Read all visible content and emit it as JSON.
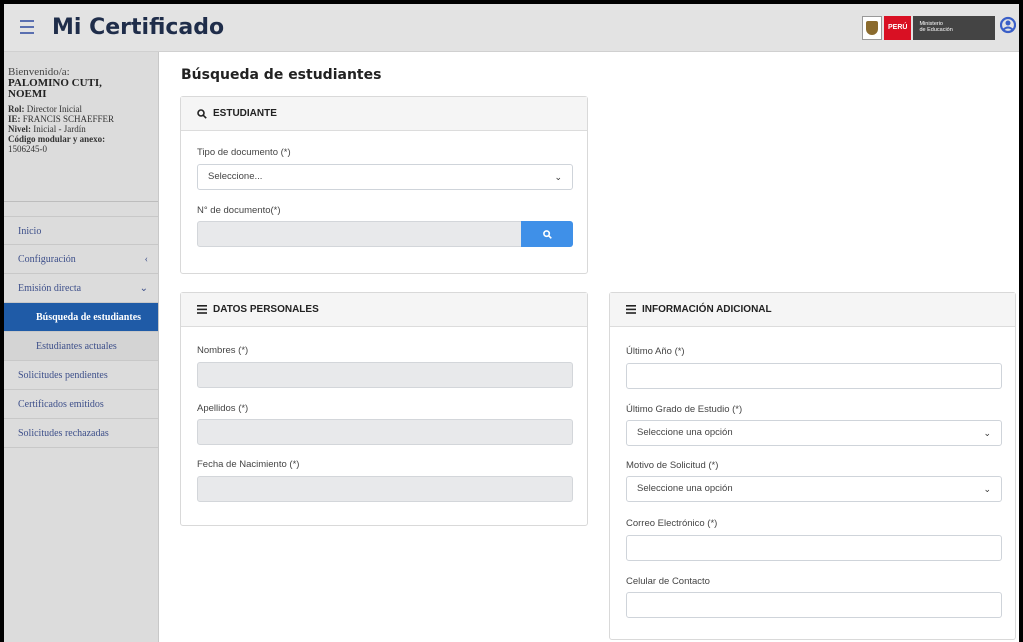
{
  "header": {
    "title": "Mi Certificado",
    "logo_country": "PERÚ",
    "logo_ministry_line1": "Ministerio",
    "logo_ministry_line2": "de Educación"
  },
  "sidebar": {
    "welcome": "Bienvenido/a:",
    "user_name": "PALOMINO CUTI, NOEMI",
    "role_label": "Rol:",
    "role_value": "Director Inicial",
    "ie_label": "IE:",
    "ie_value": "FRANCIS SCHAEFFER",
    "level_label": "Nivel:",
    "level_value": "Inicial - Jardín",
    "code_label": "Código modular y anexo:",
    "code_value": "1506245-0",
    "items": [
      {
        "label": "Inicio"
      },
      {
        "label": "Configuración"
      },
      {
        "label": "Emisión directa"
      },
      {
        "label": "Búsqueda de estudiantes"
      },
      {
        "label": "Estudiantes actuales"
      },
      {
        "label": "Solicitudes pendientes"
      },
      {
        "label": "Certificados emitidos"
      },
      {
        "label": "Solicitudes rechazadas"
      }
    ]
  },
  "main": {
    "page_title": "Búsqueda de estudiantes",
    "student_card": {
      "header": "ESTUDIANTE",
      "doc_type_label": "Tipo de documento (*)",
      "doc_type_value": "Seleccione...",
      "doc_number_label": "N° de documento(*)"
    },
    "personal_card": {
      "header": "DATOS PERSONALES",
      "names_label": "Nombres (*)",
      "surnames_label": "Apellidos (*)",
      "birthdate_label": "Fecha de Nacimiento (*)"
    },
    "additional_card": {
      "header": "INFORMACIÓN ADICIONAL",
      "last_year_label": "Último Año (*)",
      "last_grade_label": "Último Grado de Estudio (*)",
      "last_grade_value": "Seleccione una opción",
      "reason_label": "Motivo de Solicitud (*)",
      "reason_value": "Seleccione una opción",
      "email_label": "Correo Electrónico (*)",
      "phone_label": "Celular de Contacto"
    }
  },
  "colors": {
    "active_menu": "#1f5ba7",
    "search_button": "#3f90e8",
    "title_dark": "#1f2d4a"
  }
}
